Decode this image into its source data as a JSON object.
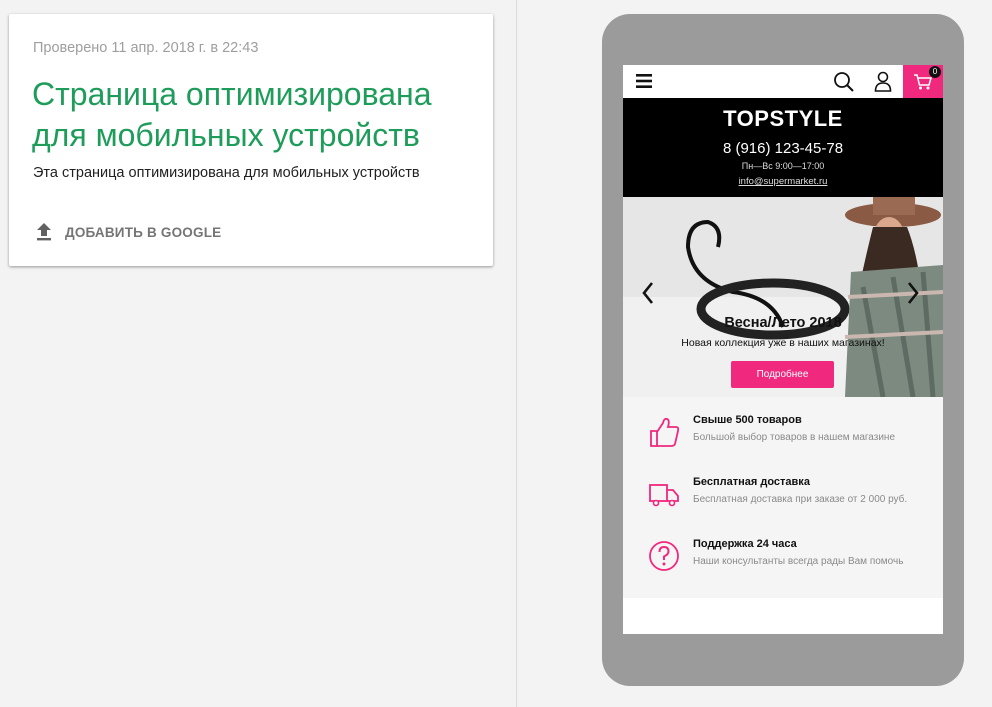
{
  "result": {
    "checked": "Проверено 11 апр. 2018 г. в 22:43",
    "headline": "Страница оптимизирована для мобильных устройств",
    "subtext": "Эта страница оптимизирована для мобильных устройств",
    "add_label": "ДОБАВИТЬ В GOOGLE",
    "accent_color": "#1e9c5a"
  },
  "site": {
    "cart_count": "0",
    "brand": "TOPSTYLE",
    "phone": "8 (916) 123-45-78",
    "hours": "Пн—Вс 9:00—17:00",
    "email": "info@supermarket.ru",
    "accent_color": "#f0287e",
    "slide": {
      "title": "Весна/Лето 2018",
      "subtitle": "Новая коллекция уже в наших магазинах!",
      "button": "Подробнее"
    },
    "features": [
      {
        "icon": "thumbs-up-icon",
        "title": "Свыше 500 товаров",
        "desc": "Большой выбор товаров в нашем магазине"
      },
      {
        "icon": "delivery-truck-icon",
        "title": "Бесплатная доставка",
        "desc": "Бесплатная доставка при заказе от 2 000 руб."
      },
      {
        "icon": "question-icon",
        "title": "Поддержка 24 часа",
        "desc": "Наши консультанты всегда рады Вам помочь"
      }
    ]
  }
}
